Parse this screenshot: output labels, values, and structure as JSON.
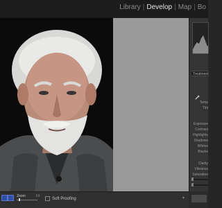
{
  "app": {
    "modules": [
      "Library",
      "Develop",
      "Map"
    ],
    "active_module": "Develop",
    "overflow_module": "Bo"
  },
  "right_panel": {
    "section_header": "Treatment",
    "param_labels": [
      "Temp",
      "Tint",
      "Exposure",
      "Contrast",
      "Highlights",
      "Shadows",
      "Whites",
      "Blacks",
      "Clarity",
      "Vibrance",
      "Saturation"
    ]
  },
  "toolbar": {
    "zoom_label": "Zoom",
    "zoom_value": "Fit",
    "soft_proofing_label": "Soft Proofing"
  },
  "colors": {
    "accent_blue": "#2f4fa7",
    "canvas_gray": "#9a9a9a",
    "panel_dark": "#343434"
  }
}
